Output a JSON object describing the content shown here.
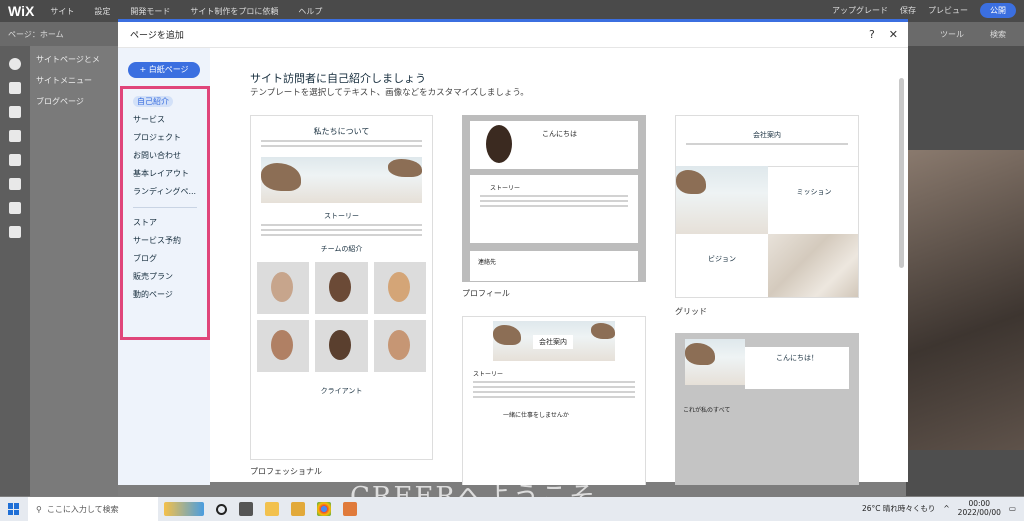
{
  "editor": {
    "logo": "WiX",
    "menu": [
      "サイト",
      "設定",
      "開発モード",
      "サイト制作をプロに依頼",
      "ヘルプ"
    ],
    "upgrade": "アップグレード",
    "save": "保存",
    "preview": "プレビュー",
    "publish": "公開",
    "page_selector": "ページ：ホーム",
    "tools": "ツール",
    "search": "検索"
  },
  "bg_panel": {
    "title": "サイトページとメ",
    "items": [
      "サイトメニュー",
      "ブログページ"
    ]
  },
  "bottom_text": "CREERへようこそ",
  "modal": {
    "title": "ページを追加",
    "help": "?",
    "close": "✕",
    "new_page": "+ 白紙ページ",
    "heading": "サイト訪問者に自己紹介しましょう",
    "subheading": "テンプレートを選択してテキスト、画像などをカスタマイズしましょう。",
    "categories": [
      "自己紹介",
      "サービス",
      "プロジェクト",
      "お問い合わせ",
      "基本レイアウト",
      "ランディングペ..."
    ],
    "categories2": [
      "ストア",
      "サービス予約",
      "ブログ",
      "販売プラン",
      "動的ページ"
    ],
    "templates": [
      {
        "caption": "プロフェッショナル",
        "title": "私たちについて",
        "story": "ストーリー",
        "team": "チームの紹介",
        "client": "クライアント"
      },
      {
        "caption": "プロフィール",
        "hello": "こんにちは",
        "story": "ストーリー",
        "contact": "連絡先"
      },
      {
        "caption": "グリッド",
        "title": "会社案内",
        "mission": "ミッション",
        "vision": "ビジョン"
      },
      {
        "caption": "",
        "title": "会社案内",
        "story": "ストーリー",
        "work": "一緒に仕事をしませんか"
      },
      {
        "caption": "",
        "hello": "こんにちは！",
        "all": "これが私のすべて"
      }
    ]
  },
  "taskbar": {
    "search_placeholder": "ここに入力して検索",
    "weather": "26°C 晴れ時々くもり",
    "time": "00:00",
    "date": "2022/00/00"
  }
}
